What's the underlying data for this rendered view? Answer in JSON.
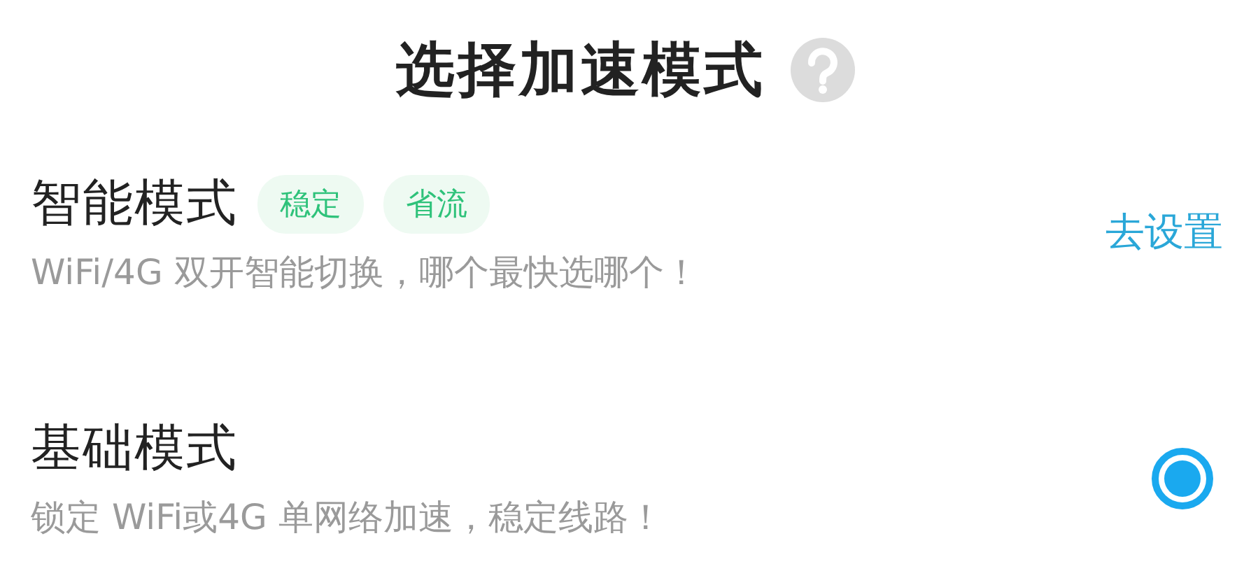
{
  "title": "选择加速模式",
  "modes": [
    {
      "kind": "setting",
      "name": "智能模式",
      "tags": [
        "稳定",
        "省流"
      ],
      "description": "WiFi/4G 双开智能切换，哪个最快选哪个！",
      "action": "去设置"
    },
    {
      "kind": "radio",
      "name": "基础模式",
      "description": "锁定 WiFi或4G 单网络加速，稳定线路！",
      "selected": true
    }
  ]
}
